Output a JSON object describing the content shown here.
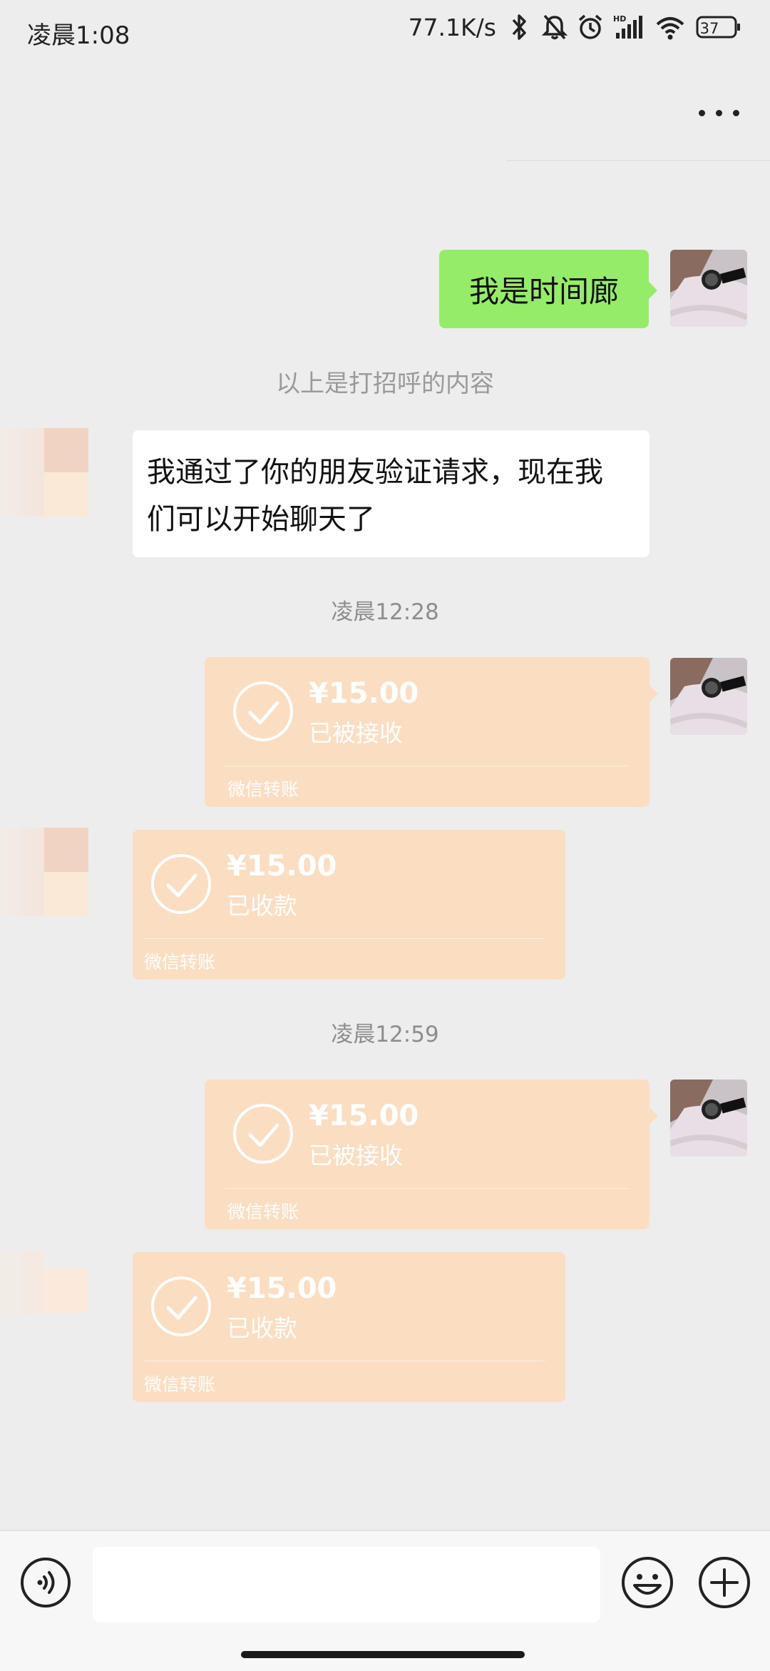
{
  "status_bar": {
    "time": "凌晨1:08",
    "net_speed": "77.1K/s",
    "battery": "37"
  },
  "chat": {
    "greeting_message": "我是时间廊",
    "system_note": "以上是打招呼的内容",
    "friend_message": "我通过了你的朋友验证请求，现在我们可以开始聊天了",
    "time_1": "凌晨12:28",
    "time_2": "凌晨12:59",
    "transfers": [
      {
        "amount": "¥15.00",
        "status": "已被接收",
        "label": "微信转账",
        "direction": "sent"
      },
      {
        "amount": "¥15.00",
        "status": "已收款",
        "label": "微信转账",
        "direction": "received"
      },
      {
        "amount": "¥15.00",
        "status": "已被接收",
        "label": "微信转账",
        "direction": "sent"
      },
      {
        "amount": "¥15.00",
        "status": "已收款",
        "label": "微信转账",
        "direction": "received"
      }
    ]
  },
  "input": {
    "placeholder": ""
  },
  "colors": {
    "background": "#ededed",
    "sent_bubble": "#95ec69",
    "transfer_bubble": "#fbdec1",
    "received_bubble": "#ffffff"
  },
  "icons": [
    "bluetooth-icon",
    "mute-icon",
    "alarm-icon",
    "signal-icon",
    "wifi-icon",
    "battery-icon",
    "more-icon",
    "check-icon",
    "voice-icon",
    "emoji-icon",
    "plus-icon"
  ]
}
